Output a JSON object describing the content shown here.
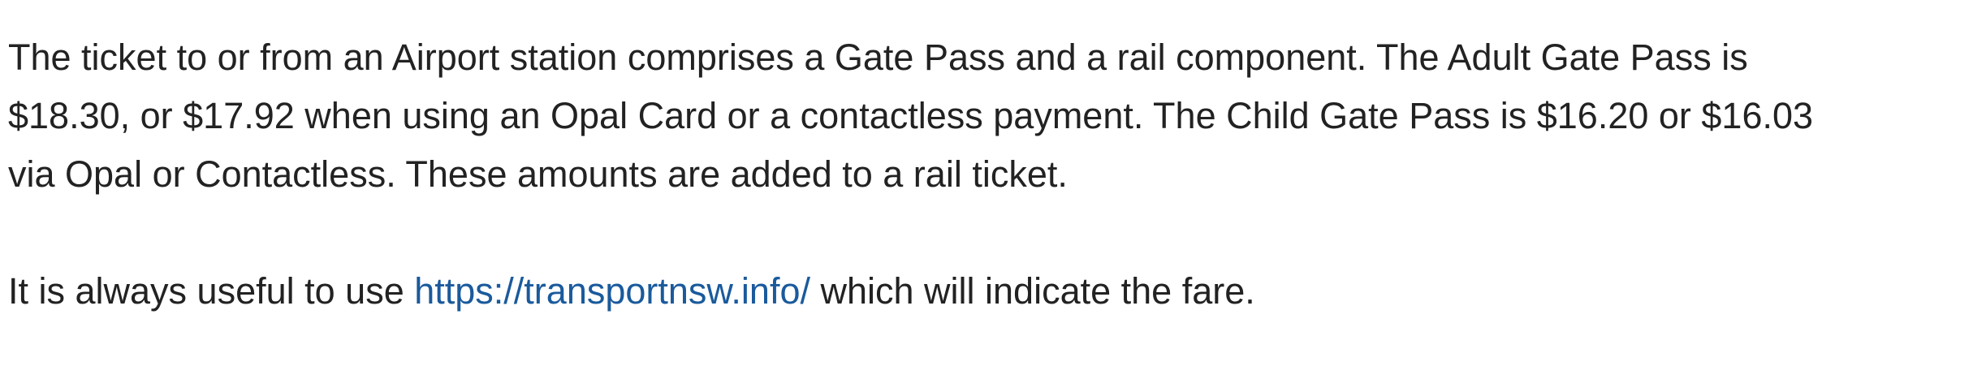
{
  "paragraph1": {
    "line1": "The ticket to or from an Airport station comprises a Gate Pass and a rail component. The Adult Gate Pass is",
    "line2": "$18.30, or $17.92 when using an Opal Card or a contactless payment. The Child Gate Pass is $16.20 or $16.03",
    "line3": "via Opal or Contactless. These amounts are added to a rail ticket."
  },
  "paragraph2": {
    "before_link": "It is always useful to use ",
    "link_text": "https://transportnsw.info/",
    "after_link": " which will indicate the fare."
  },
  "colors": {
    "text": "#222222",
    "link": "#1a5a9c",
    "background": "#ffffff"
  }
}
